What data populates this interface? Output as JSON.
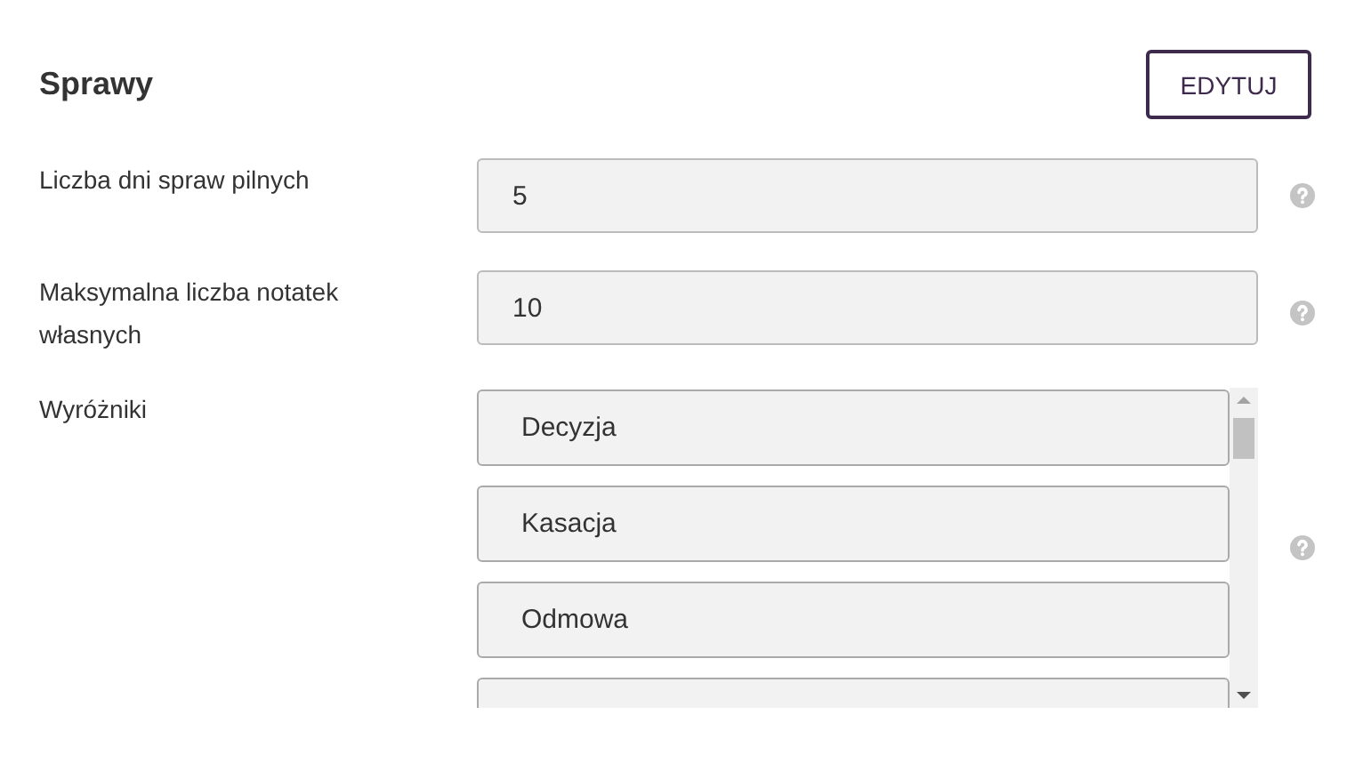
{
  "section": {
    "title": "Sprawy",
    "edit_button": "EDYTUJ"
  },
  "fields": [
    {
      "label": "Liczba dni spraw pilnych",
      "value": "5",
      "disabled": true
    },
    {
      "label": "Maksymalna liczba notatek własnych",
      "value": "10",
      "disabled": true
    }
  ],
  "highlights": {
    "label": "Wyróżniki",
    "items": [
      "Decyzja",
      "Kasacja",
      "Odmowa"
    ],
    "more_below": true
  }
}
